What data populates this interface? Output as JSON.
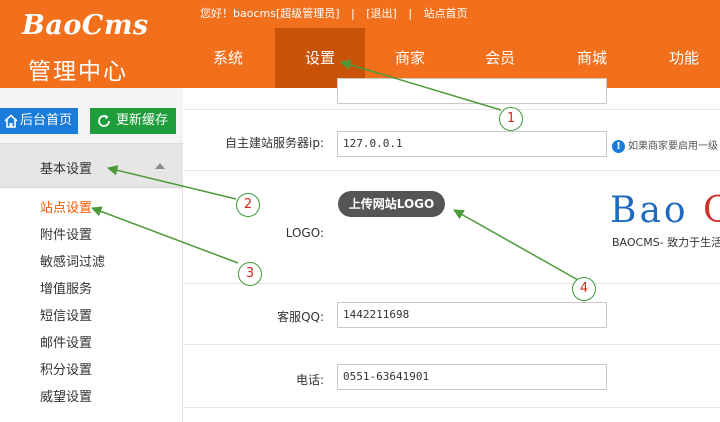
{
  "brand": {
    "logo": "BaoCms",
    "title": "管理中心"
  },
  "topbar": {
    "greeting": "您好！baocms[超级管理员]",
    "separator": "|",
    "logout": "[退出]",
    "site_home": "站点首页"
  },
  "nav": {
    "items": [
      {
        "label": "系统"
      },
      {
        "label": "设置"
      },
      {
        "label": "商家"
      },
      {
        "label": "会员"
      },
      {
        "label": "商城"
      },
      {
        "label": "功能"
      }
    ],
    "active": "设置"
  },
  "sidebar": {
    "home_button": "后台首页",
    "refresh_button": "更新缓存",
    "section_title": "基本设置",
    "items": [
      {
        "label": "站点设置"
      },
      {
        "label": "附件设置"
      },
      {
        "label": "敏感词过滤"
      },
      {
        "label": "增值服务"
      },
      {
        "label": "短信设置"
      },
      {
        "label": "邮件设置"
      },
      {
        "label": "积分设置"
      },
      {
        "label": "威望设置"
      }
    ],
    "active": "站点设置"
  },
  "form": {
    "server_ip": {
      "label": "自主建站服务器ip:",
      "value": "127.0.0.1",
      "hint": "如果商家要启用一级"
    },
    "logo": {
      "label": "LOGO:",
      "upload_button": "上传网站LOGO",
      "preview_text": "Bao C",
      "preview_slogan": "BAOCMS- 致力于生活"
    },
    "qq": {
      "label": "客服QQ:",
      "value": "1442211698"
    },
    "phone": {
      "label": "电话:",
      "value": "0551-63641901"
    }
  },
  "callouts": [
    "1",
    "2",
    "3",
    "4"
  ],
  "colors": {
    "header": "#f26f1c",
    "nav_active": "#c85208",
    "active_text": "#ee5a00",
    "callout_border": "#3c9a3c",
    "callout_text": "#d52a1a",
    "arrow": "#4d9a3a"
  }
}
